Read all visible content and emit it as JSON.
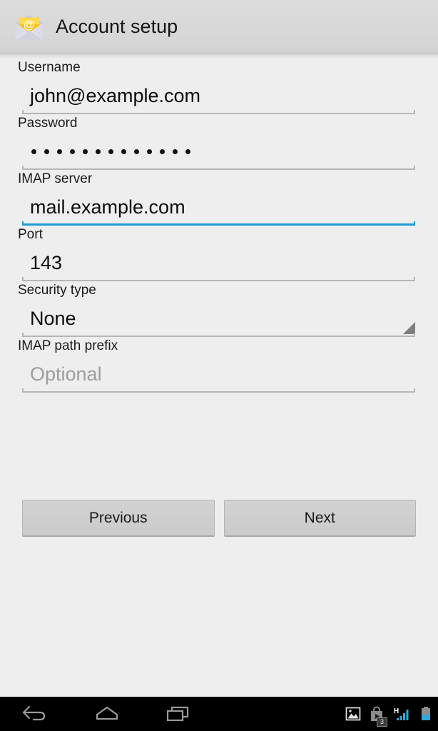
{
  "actionbar": {
    "icon": "email-app-icon",
    "title": "Account setup"
  },
  "form": {
    "fields": [
      {
        "name": "username",
        "label": "Username",
        "value": "john@example.com",
        "type": "text",
        "focused": false
      },
      {
        "name": "password",
        "label": "Password",
        "value": "",
        "type": "password",
        "dot_count": 13,
        "focused": false
      },
      {
        "name": "imap-server",
        "label": "IMAP server",
        "value": "mail.example.com",
        "type": "text",
        "focused": true
      },
      {
        "name": "port",
        "label": "Port",
        "value": "143",
        "type": "number",
        "focused": false
      },
      {
        "name": "security-type",
        "label": "Security type",
        "value": "None",
        "type": "spinner",
        "focused": false
      },
      {
        "name": "imap-path-prefix",
        "label": "IMAP path prefix",
        "value": "",
        "placeholder": "Optional",
        "type": "text",
        "focused": false
      }
    ]
  },
  "buttons": {
    "previous_label": "Previous",
    "next_label": "Next"
  },
  "navbar": {
    "back": "back-icon",
    "home": "home-icon",
    "recents": "recents-icon",
    "status": {
      "screenshot": "image-icon",
      "play_store": "play-store-icon",
      "play_store_badge": "3",
      "network_type": "H",
      "signal": "signal-bars-icon",
      "battery": "battery-icon"
    }
  },
  "colors": {
    "accent": "#1b9dd6",
    "actionbar_bg": "#d7d7d7",
    "content_bg": "#eeeeee",
    "button_bg": "#cbcbcb",
    "navbar_bg": "#000000"
  }
}
